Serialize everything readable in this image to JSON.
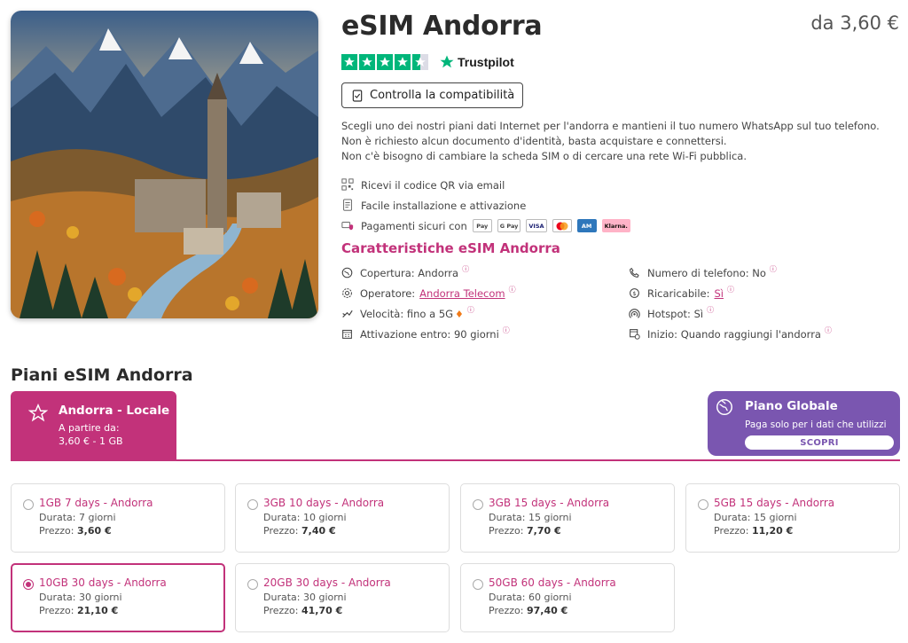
{
  "product": {
    "title": "eSIM Andorra",
    "price": "da 3,60 €",
    "rating_stars": 4.5,
    "trustpilot_label": "Trustpilot",
    "compat_button": "Controlla la compatibilità",
    "description": [
      "Scegli uno dei nostri piani dati Internet per l'andorra e mantieni il tuo numero WhatsApp sul tuo telefono.",
      "Non è richiesto alcun documento d'identità, basta acquistare e connettersi.",
      "Non c'è bisogno di cambiare la scheda SIM o di cercare una rete Wi-Fi pubblica."
    ],
    "features": [
      {
        "icon": "qr-code-icon",
        "text": "Ricevi il codice QR via email"
      },
      {
        "icon": "document-icon",
        "text": "Facile installazione e attivazione"
      },
      {
        "icon": "secure-card-icon",
        "text": "Pagamenti sicuri con"
      }
    ],
    "payment_methods": [
      "Apple Pay",
      "G Pay",
      "VISA",
      "Mastercard",
      "American Express",
      "Klarna"
    ]
  },
  "characteristics": {
    "title": "Caratteristiche eSIM Andorra",
    "left": [
      {
        "icon": "globe-icon",
        "label": "Copertura:",
        "value": "Andorra"
      },
      {
        "icon": "gear-icon",
        "label": "Operatore:",
        "value": "Andorra Telecom"
      },
      {
        "icon": "speed-icon",
        "label": "Velocità:",
        "value": "fino a 5G"
      },
      {
        "icon": "calendar-icon",
        "label": "Attivazione entro:",
        "value": "90 giorni"
      }
    ],
    "right": [
      {
        "icon": "phone-icon",
        "label": "Numero di telefono:",
        "value": "No"
      },
      {
        "icon": "recharge-icon",
        "label": "Ricaricabile:",
        "value": "Sì"
      },
      {
        "icon": "hotspot-icon",
        "label": "Hotspot:",
        "value": "Sì"
      },
      {
        "icon": "calendar-start-icon",
        "label": "Inizio:",
        "value": "Quando raggiungi l'andorra"
      }
    ]
  },
  "plans": {
    "title": "Piani eSIM Andorra",
    "local_tab": {
      "title": "Andorra - Locale",
      "subtitle": "A partire da:",
      "from": "3,60 € - 1 GB"
    },
    "global": {
      "title": "Piano Globale",
      "subtitle": "Paga solo per i dati che utilizzi",
      "button": "SCOPRI"
    },
    "duration_label": "Durata:",
    "price_label": "Prezzo:",
    "items": [
      {
        "name": "1GB 7 days - Andorra",
        "duration": "7 giorni",
        "price": "3,60 €",
        "selected": false
      },
      {
        "name": "3GB 10 days - Andorra",
        "duration": "10 giorni",
        "price": "7,40 €",
        "selected": false
      },
      {
        "name": "3GB 15 days - Andorra",
        "duration": "15 giorni",
        "price": "7,70 €",
        "selected": false
      },
      {
        "name": "5GB 15 days - Andorra",
        "duration": "15 giorni",
        "price": "11,20 €",
        "selected": false
      },
      {
        "name": "10GB 30 days - Andorra",
        "duration": "30 giorni",
        "price": "21,10 €",
        "selected": true
      },
      {
        "name": "20GB 30 days - Andorra",
        "duration": "30 giorni",
        "price": "41,70 €",
        "selected": false
      },
      {
        "name": "50GB 60 days - Andorra",
        "duration": "60 giorni",
        "price": "97,40 €",
        "selected": false
      }
    ]
  },
  "colors": {
    "accent": "#c2327a",
    "global": "#7a56b0",
    "trustpilot": "#00b67a"
  }
}
